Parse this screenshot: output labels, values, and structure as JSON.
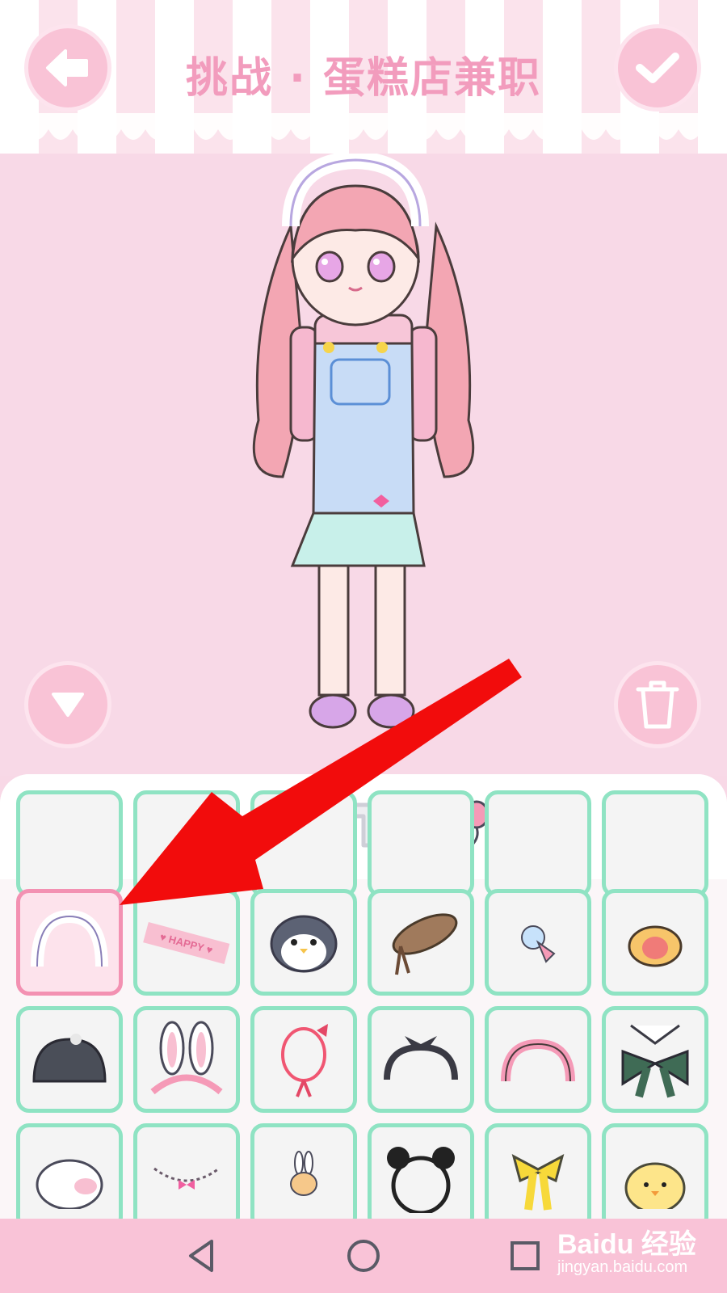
{
  "header": {
    "title": "挑战 · 蛋糕店兼职",
    "back_icon": "arrow-left-icon",
    "confirm_icon": "checkmark-icon"
  },
  "stage": {
    "character": "pink-haired-girl-in-blue-overalls",
    "collapse_icon": "triangle-down-icon",
    "delete_icon": "trash-icon"
  },
  "tabs": [
    {
      "icon": "shop-icon",
      "selected": true
    },
    {
      "icon": "sock-icon",
      "selected": false
    },
    {
      "icon": "glasses-icon",
      "selected": false
    },
    {
      "icon": "tshirt-icon",
      "selected": false
    },
    {
      "icon": "balloons-icon",
      "selected": false
    },
    {
      "icon": "lock-bag-icon",
      "selected": false
    },
    {
      "icon": "star-icon",
      "selected": false
    }
  ],
  "items": {
    "row1": [
      "lace-headband",
      "happy-tape-clip",
      "penguin-clip",
      "ribbon-hat",
      "ice-cream-clip",
      "crown-clip"
    ],
    "row2": [
      "beanie-hat",
      "bunny-ears-headband",
      "red-bow-headband",
      "black-bandana-headband",
      "pink-headband",
      "green-striped-bow"
    ],
    "row3": [
      "pig-hat",
      "bow-chain",
      "bunny-clip",
      "panda-headband",
      "yellow-bow",
      "chick-hat"
    ],
    "happy_label": "♥ HAPPY ♥",
    "selected": "lace-headband"
  },
  "watermark": {
    "logo": "Baidu 经验",
    "url": "jingyan.baidu.com"
  },
  "colors": {
    "accent_pink": "#f29cbd",
    "cell_border": "#8fe3c3",
    "selected_border": "#f391b2",
    "annotation_arrow": "#f20c0c"
  }
}
